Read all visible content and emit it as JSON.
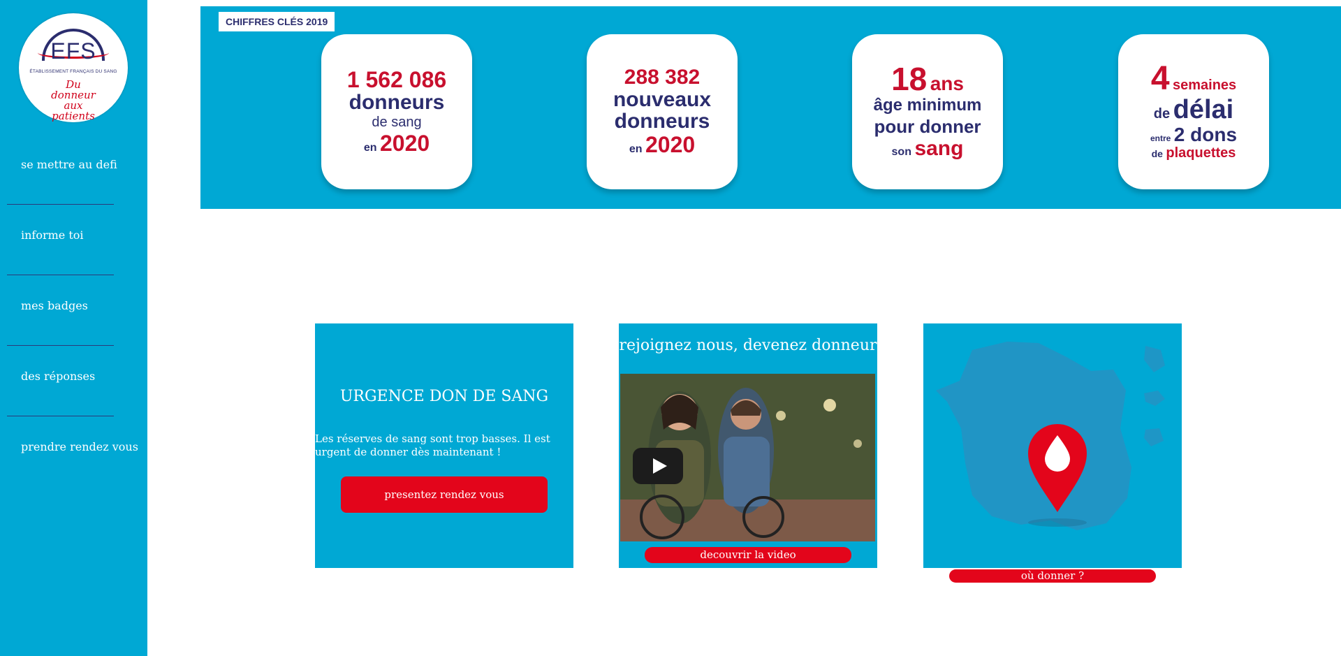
{
  "logo": {
    "text": "EFS",
    "subtitle": "ÉTABLISSEMENT FRANÇAIS DU SANG",
    "tagline": "Du donneur aux patients"
  },
  "sidebar": {
    "items": [
      {
        "label": "se mettre au defi"
      },
      {
        "label": "informe toi"
      },
      {
        "label": "mes badges"
      },
      {
        "label": "des réponses"
      },
      {
        "label": "prendre rendez vous"
      }
    ]
  },
  "stats": {
    "tag": "CHIFFRES CLÉS 2019",
    "cards": [
      {
        "l1": "1 562 086",
        "l2": "donneurs",
        "l3": "de sang",
        "l4a": "en",
        "l4b": "2020"
      },
      {
        "l1": "288 382",
        "l2": "nouveaux",
        "l3": "donneurs",
        "l4a": "en",
        "l4b": "2020"
      },
      {
        "l1a": "18",
        "l1b": "ans",
        "l2": "âge minimum",
        "l3": "pour donner",
        "l4a": "son",
        "l4b": "sang"
      },
      {
        "l1a": "4",
        "l1b": "semaines",
        "l2a": "de",
        "l2b": "délai",
        "l3a": "entre",
        "l3b": "2 dons",
        "l4a": "de",
        "l4b": "plaquettes"
      }
    ]
  },
  "urgence": {
    "title": "URGENCE DON DE SANG",
    "text": "Les réserves de sang sont trop basses. Il est urgent de donner dès maintenant !",
    "button": "presentez rendez vous"
  },
  "video": {
    "title": "rejoignez nous, devenez donneur",
    "button": "decouvrir la video"
  },
  "map": {
    "button": "où donner ?"
  },
  "colors": {
    "accent": "#00a8d4",
    "brand_red": "#e3051b",
    "navy": "#2b2d6e"
  }
}
